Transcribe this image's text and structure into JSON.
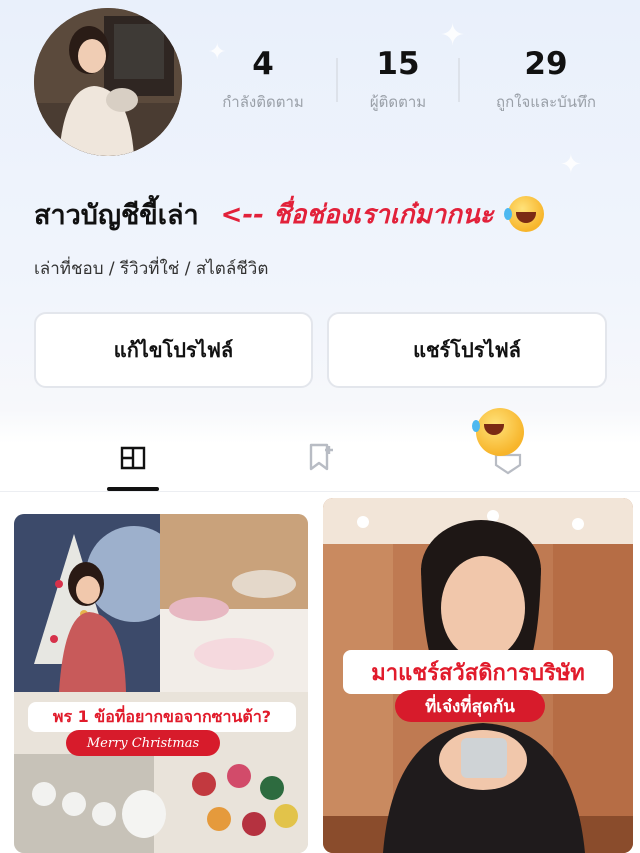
{
  "profile": {
    "stats": [
      {
        "value": "4",
        "label": "กำลังติดตาม"
      },
      {
        "value": "15",
        "label": "ผู้ติดตาม"
      },
      {
        "value": "29",
        "label": "ถูกใจและบันทึก"
      }
    ],
    "name": "สาวบัญชีขี้เล่า",
    "annotation": "<-- ชื่อช่องเราเก๋มากนะ",
    "bio": "เล่าที่ชอบ / รีวิวที่ใช่ / สไตล์ชีวิต",
    "avatar_icon": "avatar"
  },
  "actions": {
    "edit_label": "แก้ไขโปรไฟล์",
    "share_label": "แชร์โปรไฟล์"
  },
  "tabs": [
    {
      "icon": "posts-grid-icon",
      "active": true
    },
    {
      "icon": "saved-bookmark-icon",
      "active": false
    },
    {
      "icon": "liked-heart-icon",
      "active": false
    }
  ],
  "posts": [
    {
      "headline": "พร 1 ข้อที่อยากขอจากซานต้า?",
      "tag": "Merry Christmas"
    },
    {
      "headline": "มาแชร์สวัสดิการบริษัท",
      "tag": "ที่เจ๋งที่สุดกัน"
    }
  ],
  "colors": {
    "accent_red": "#e2213a",
    "banner_red": "#d71b2b"
  }
}
